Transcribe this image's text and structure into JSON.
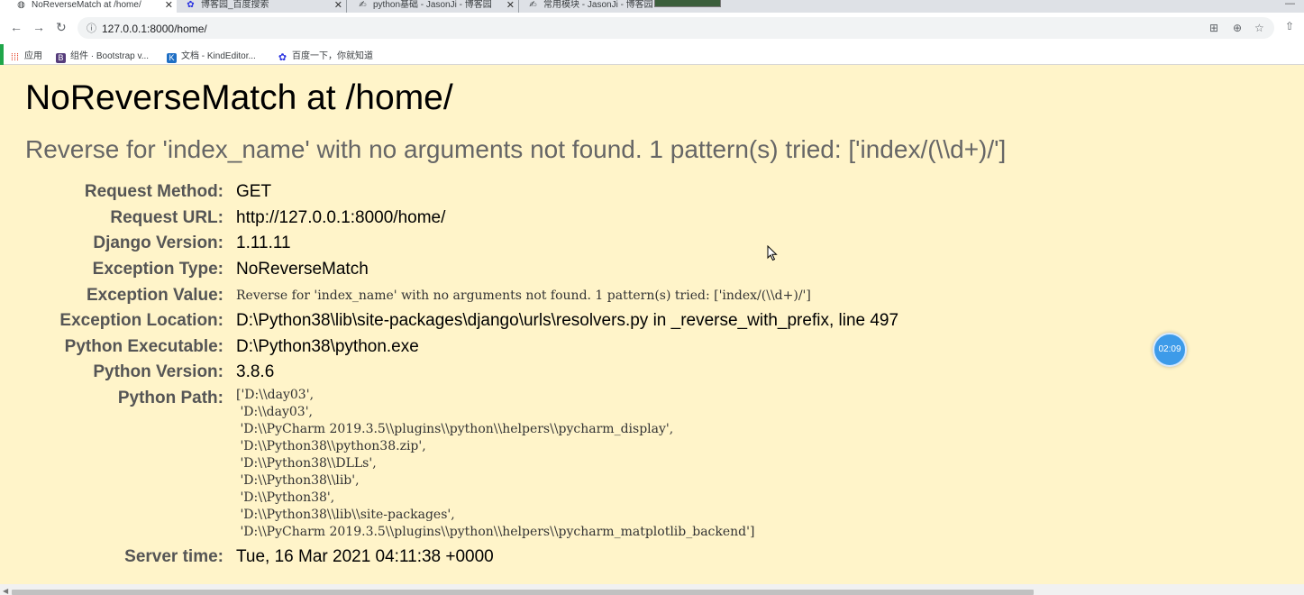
{
  "browser": {
    "tabs": [
      {
        "title": "NoReverseMatch at /home/",
        "icon": "globe-icon",
        "active": true
      },
      {
        "title": "博客园_百度搜索",
        "icon": "paw-icon"
      },
      {
        "title": "python基础 - JasonJi - 博客园",
        "icon": "cnblogs-icon"
      },
      {
        "title": "常用模块 - JasonJi - 博客园",
        "icon": "cnblogs-icon"
      }
    ],
    "url": "127.0.0.1:8000/home/",
    "bookmarks": [
      {
        "label": "应用",
        "icon": "apps-grid-icon"
      },
      {
        "label": "组件 · Bootstrap v...",
        "icon": "bootstrap-icon",
        "glyph": "B",
        "color": "#563d7c"
      },
      {
        "label": "文档 - KindEditor...",
        "icon": "kindeditor-icon",
        "glyph": "K",
        "color": "#1f6fc5"
      },
      {
        "label": "百度一下，你就知道",
        "icon": "baidu-paw-icon"
      }
    ]
  },
  "error": {
    "title": "NoReverseMatch at /home/",
    "subtitle": "Reverse for 'index_name' with no arguments not found. 1 pattern(s) tried: ['index/(\\\\d+)/']",
    "details": [
      {
        "key": "Request Method:",
        "value": "GET"
      },
      {
        "key": "Request URL:",
        "value": "http://127.0.0.1:8000/home/"
      },
      {
        "key": "Django Version:",
        "value": "1.11.11"
      },
      {
        "key": "Exception Type:",
        "value": "NoReverseMatch"
      },
      {
        "key": "Exception Value:",
        "value": "Reverse for 'index_name' with no arguments not found. 1 pattern(s) tried: ['index/(\\\\d+)/']"
      },
      {
        "key": "Exception Location:",
        "value": "D:\\Python38\\lib\\site-packages\\django\\urls\\resolvers.py in _reverse_with_prefix, line 497"
      },
      {
        "key": "Python Executable:",
        "value": "D:\\Python38\\python.exe"
      },
      {
        "key": "Python Version:",
        "value": "3.8.6"
      },
      {
        "key": "Python Path:",
        "value": ""
      },
      {
        "key": "Server time:",
        "value": "Tue, 16 Mar 2021 04:11:38 +0000"
      }
    ],
    "python_path": [
      "['D:\\\\day03',",
      " 'D:\\\\day03',",
      " 'D:\\\\PyCharm 2019.3.5\\\\plugins\\\\python\\\\helpers\\\\pycharm_display',",
      " 'D:\\\\Python38\\\\python38.zip',",
      " 'D:\\\\Python38\\\\DLLs',",
      " 'D:\\\\Python38\\\\lib',",
      " 'D:\\\\Python38',",
      " 'D:\\\\Python38\\\\lib\\\\site-packages',",
      " 'D:\\\\PyCharm 2019.3.5\\\\plugins\\\\python\\\\helpers\\\\pycharm_matplotlib_backend']"
    ]
  },
  "overlay": {
    "timer": "02:09"
  }
}
